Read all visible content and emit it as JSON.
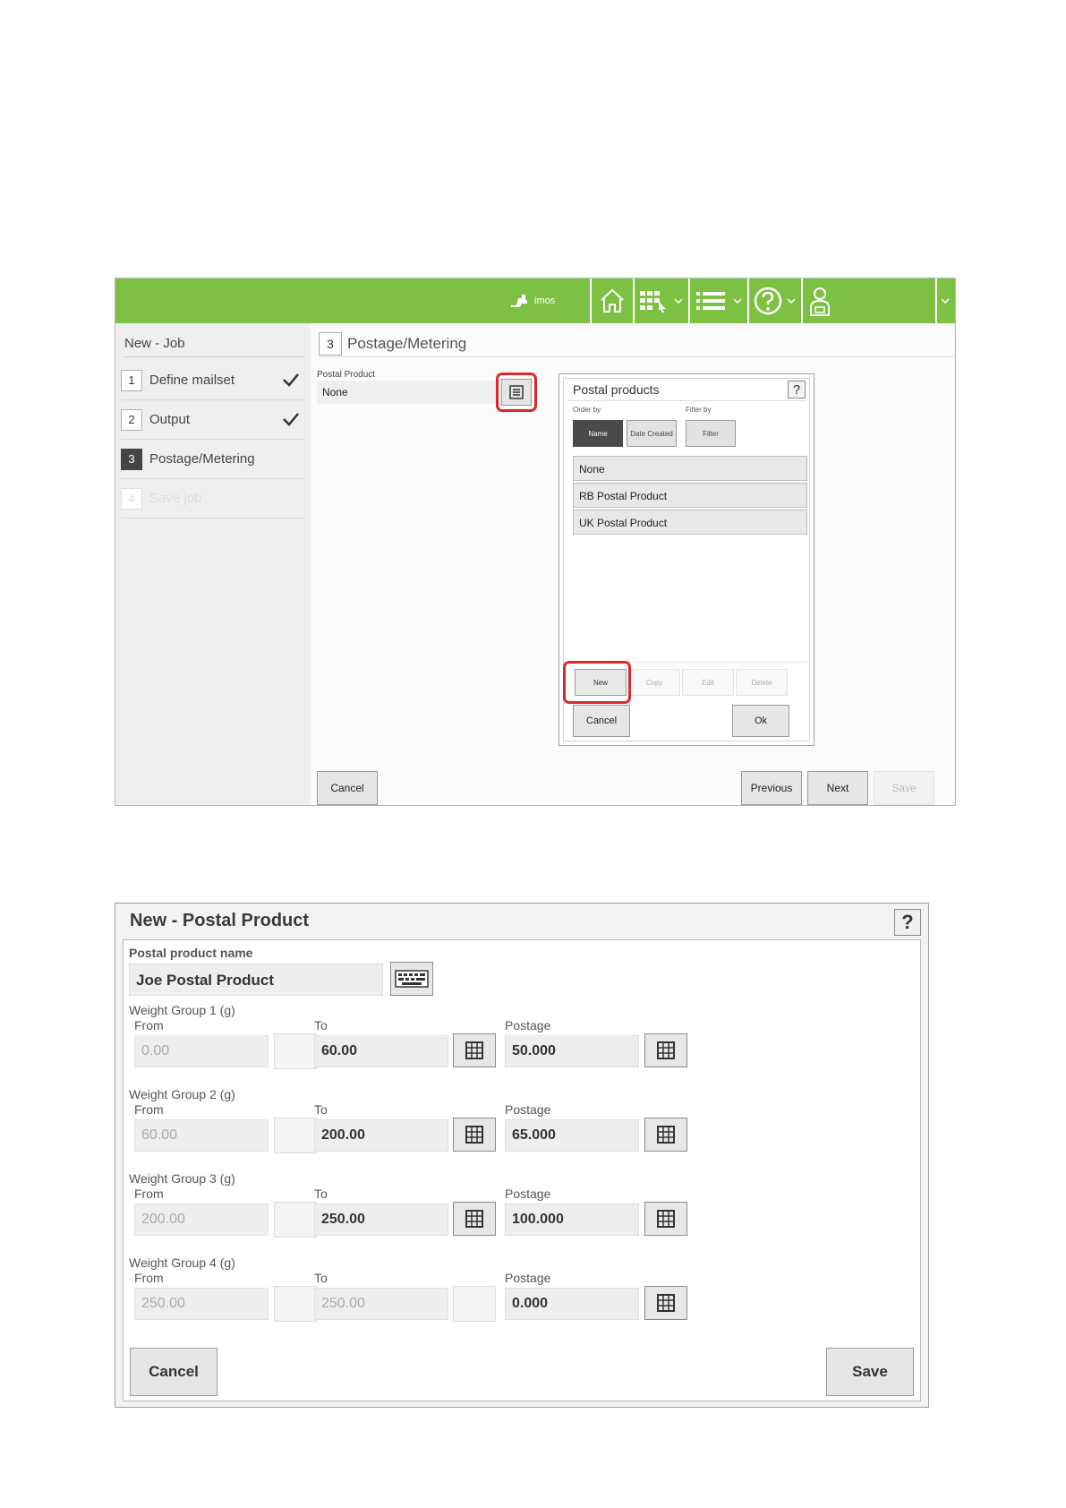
{
  "screen1": {
    "brand": "imos",
    "sidebar": {
      "title": "New - Job",
      "steps": [
        {
          "num": "1",
          "label": "Define mailset"
        },
        {
          "num": "2",
          "label": "Output"
        },
        {
          "num": "3",
          "label": "Postage/Metering"
        },
        {
          "num": "4",
          "label": "Save job"
        }
      ]
    },
    "page": {
      "num": "3",
      "title": "Postage/Metering",
      "postal_product_label": "Postal Product",
      "postal_product_value": "None"
    },
    "dialog": {
      "title": "Postal products",
      "help": "?",
      "order_by_label": "Order by",
      "filter_by_label": "Filter by",
      "order_buttons": [
        "Name",
        "Date Created"
      ],
      "filter_button": "Filter",
      "items": [
        "None",
        "RB Postal Product",
        "UK Postal Product"
      ],
      "actions": [
        "New",
        "Copy",
        "Edit",
        "Delete"
      ],
      "cancel": "Cancel",
      "ok": "Ok"
    },
    "buttons": {
      "cancel": "Cancel",
      "previous": "Previous",
      "next": "Next",
      "save": "Save"
    },
    "colors": {
      "topbar": "#7dc142",
      "highlight": "#e0262b"
    }
  },
  "screen2": {
    "title": "New - Postal Product",
    "help": "?",
    "name_label": "Postal product name",
    "name_value": "Joe Postal Product",
    "from_label": "From",
    "to_label": "To",
    "postage_label": "Postage",
    "groups": [
      {
        "label": "Weight Group 1 (g)",
        "from": "0.00",
        "to": "60.00",
        "postage": "50.000"
      },
      {
        "label": "Weight Group 2 (g)",
        "from": "60.00",
        "to": "200.00",
        "postage": "65.000"
      },
      {
        "label": "Weight Group 3 (g)",
        "from": "200.00",
        "to": "250.00",
        "postage": "100.000"
      },
      {
        "label": "Weight Group 4 (g)",
        "from": "250.00",
        "to": "250.00",
        "postage": "0.000"
      }
    ],
    "cancel": "Cancel",
    "save": "Save"
  }
}
